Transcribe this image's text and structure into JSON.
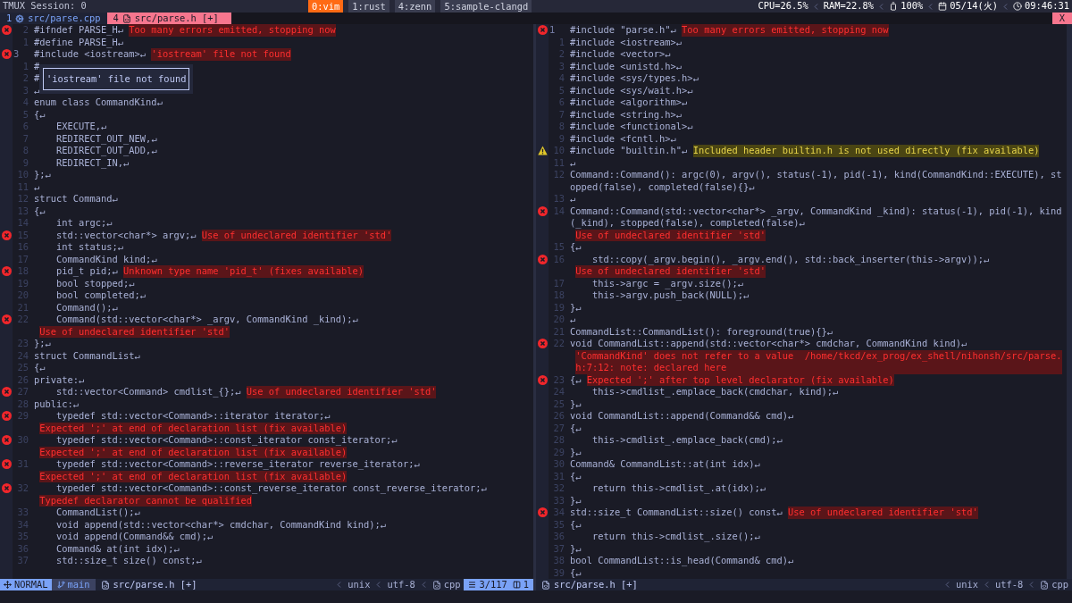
{
  "tmux": {
    "session": "TMUX Session: 0",
    "windows": [
      {
        "label": "0:vim",
        "selected": true
      },
      {
        "label": "1:rust",
        "selected": false
      },
      {
        "label": "4:zenn",
        "selected": false
      },
      {
        "label": "5:sample-clangd",
        "selected": false
      }
    ],
    "status": [
      {
        "kind": "cpu",
        "text": "CPU=26.5%"
      },
      {
        "kind": "ram",
        "text": "RAM=22.8%"
      },
      {
        "kind": "battery",
        "text": "100%"
      },
      {
        "kind": "date",
        "text": "05/14(火)"
      },
      {
        "kind": "clock",
        "text": "09:46:31"
      }
    ]
  },
  "tabline": {
    "tabs": [
      {
        "number": "1",
        "kind": "source",
        "label": "src/parse.cpp",
        "selected": false
      },
      {
        "number": "4",
        "kind": "header",
        "label": "src/parse.h [+]",
        "selected": true
      }
    ],
    "close": "X"
  },
  "panes": [
    {
      "lines": [
        {
          "n": "2",
          "kind": "error",
          "code": "#ifndef PARSE_H↵",
          "diag": "Too many errors emitted, stopping now"
        },
        {
          "n": "1",
          "code": "#define PARSE_H↵"
        },
        {
          "n": "3",
          "current": true,
          "kind": "error",
          "code": "#include <iostream>↵",
          "diag": "'iostream' file not found"
        },
        {
          "n": "1",
          "code": "#"
        },
        {
          "n": "2",
          "code": "#"
        },
        {
          "n": "3",
          "code": "↵"
        },
        {
          "n": "4",
          "code": "enum class CommandKind↵"
        },
        {
          "n": "5",
          "code": "{↵"
        },
        {
          "n": "6",
          "code": "    EXECUTE,↵"
        },
        {
          "n": "7",
          "code": "    REDIRECT_OUT_NEW,↵"
        },
        {
          "n": "8",
          "code": "    REDIRECT_OUT_ADD,↵"
        },
        {
          "n": "9",
          "code": "    REDIRECT_IN,↵"
        },
        {
          "n": "10",
          "code": "};↵"
        },
        {
          "n": "11",
          "code": "↵"
        },
        {
          "n": "12",
          "code": "struct Command↵"
        },
        {
          "n": "13",
          "code": "{↵"
        },
        {
          "n": "14",
          "code": "    int argc;↵"
        },
        {
          "n": "15",
          "kind": "error",
          "code": "    std::vector<char*> argv;↵",
          "diag": "Use of undeclared identifier 'std'"
        },
        {
          "n": "16",
          "code": "    int status;↵"
        },
        {
          "n": "17",
          "code": "    CommandKind kind;↵"
        },
        {
          "n": "18",
          "kind": "error",
          "code": "    pid_t pid;↵",
          "diag": "Unknown type name 'pid_t' (fixes available)"
        },
        {
          "n": "19",
          "code": "    bool stopped;↵"
        },
        {
          "n": "20",
          "code": "    bool completed;↵"
        },
        {
          "n": "21",
          "code": "    Command();↵"
        },
        {
          "n": "22",
          "kind": "error",
          "code": "    Command(std::vector<char*> _argv, CommandKind _kind);↵",
          "diag": "Use of undeclared identifier 'std'"
        },
        {
          "n": "23",
          "code": "};↵"
        },
        {
          "n": "24",
          "code": "struct CommandList↵"
        },
        {
          "n": "25",
          "code": "{↵"
        },
        {
          "n": "26",
          "code": "private:↵"
        },
        {
          "n": "27",
          "kind": "error",
          "code": "    std::vector<Command> cmdlist_{};↵",
          "diag": "Use of undeclared identifier 'std'"
        },
        {
          "n": "28",
          "code": "public:↵"
        },
        {
          "n": "29",
          "kind": "error",
          "code": "    typedef std::vector<Command>::iterator iterator;↵",
          "diag": "Expected ';' at end of declaration list (fix available)"
        },
        {
          "n": "30",
          "kind": "error",
          "code": "    typedef std::vector<Command>::const_iterator const_iterator;↵",
          "diag": "Expected ';' at end of declaration list (fix available)"
        },
        {
          "n": "31",
          "kind": "error",
          "code": "    typedef std::vector<Command>::reverse_iterator reverse_iterator;↵",
          "diag": "Expected ';' at end of declaration list (fix available)"
        },
        {
          "n": "32",
          "kind": "error",
          "code": "    typedef std::vector<Command>::const_reverse_iterator const_reverse_iterator;↵",
          "diag": "Typedef declarator cannot be qualified"
        },
        {
          "n": "33",
          "code": "    CommandList();↵"
        },
        {
          "n": "34",
          "code": "    void append(std::vector<char*> cmdchar, CommandKind kind);↵"
        },
        {
          "n": "35",
          "code": "    void append(Command&& cmd);↵"
        },
        {
          "n": "36",
          "code": "    Command& at(int idx);↵"
        },
        {
          "n": "37",
          "code": "    std::size_t size() const;↵"
        }
      ],
      "popup": "'iostream' file not found",
      "statusline": {
        "left": [
          {
            "kind": "mode",
            "text": "NORMAL"
          },
          {
            "kind": "branch",
            "text": "main"
          },
          {
            "kind": "file",
            "text": "src/parse.h [+]"
          }
        ],
        "right": [
          {
            "kind": "plain",
            "text": "unix"
          },
          {
            "kind": "plain",
            "text": "utf-8"
          },
          {
            "kind": "filetype",
            "text": "cpp"
          },
          {
            "kind": "position",
            "text": "3/117",
            "col": "1"
          }
        ]
      }
    },
    {
      "lines": [
        {
          "n": "1",
          "current": true,
          "kind": "error",
          "code": "#include \"parse.h\"↵",
          "diag": "Too many errors emitted, stopping now"
        },
        {
          "n": "1",
          "code": "#include <iostream>↵"
        },
        {
          "n": "2",
          "code": "#include <vector>↵"
        },
        {
          "n": "3",
          "code": "#include <unistd.h>↵"
        },
        {
          "n": "4",
          "code": "#include <sys/types.h>↵"
        },
        {
          "n": "5",
          "code": "#include <sys/wait.h>↵"
        },
        {
          "n": "6",
          "code": "#include <algorithm>↵"
        },
        {
          "n": "7",
          "code": "#include <string.h>↵"
        },
        {
          "n": "8",
          "code": "#include <functional>↵"
        },
        {
          "n": "9",
          "code": "#include <fcntl.h>↵"
        },
        {
          "n": "10",
          "kind": "warning",
          "code": "#include \"builtin.h\"↵",
          "diag": "Included header builtin.h is not used directly (fix available)"
        },
        {
          "n": "11",
          "code": "↵"
        },
        {
          "n": "12",
          "code": "Command::Command(): argc(0), argv(), status(-1), pid(-1), kind(CommandKind::EXECUTE), stopped(false), completed(false){}↵"
        },
        {
          "n": "13",
          "code": "↵"
        },
        {
          "n": "14",
          "kind": "error",
          "code": "Command::Command(std::vector<char*> _argv, CommandKind _kind): status(-1), pid(-1), kind(_kind), stopped(false), completed(false)↵",
          "diag": "Use of undeclared identifier 'std'"
        },
        {
          "n": "15",
          "code": "{↵"
        },
        {
          "n": "16",
          "kind": "error",
          "code": "    std::copy(_argv.begin(), _argv.end(), std::back_inserter(this->argv));↵",
          "diag": "Use of undeclared identifier 'std'"
        },
        {
          "n": "17",
          "code": "    this->argc = _argv.size();↵"
        },
        {
          "n": "18",
          "code": "    this->argv.push_back(NULL);↵"
        },
        {
          "n": "19",
          "code": "}↵"
        },
        {
          "n": "20",
          "code": "↵"
        },
        {
          "n": "21",
          "code": "CommandList::CommandList(): foreground(true){}↵"
        },
        {
          "n": "22",
          "kind": "error",
          "code": "void CommandList::append(std::vector<char*> cmdchar, CommandKind kind)↵",
          "diag": "'CommandKind' does not refer to a value  /home/tkcd/ex_prog/ex_shell/nihonsh/src/parse.h:7:12: note: declared here"
        },
        {
          "n": "23",
          "kind": "error",
          "code": "{↵",
          "diag": "Expected ';' after top level declarator (fix available)"
        },
        {
          "n": "24",
          "code": "    this->cmdlist_.emplace_back(cmdchar, kind);↵"
        },
        {
          "n": "25",
          "code": "}↵"
        },
        {
          "n": "26",
          "code": "void CommandList::append(Command&& cmd)↵"
        },
        {
          "n": "27",
          "code": "{↵"
        },
        {
          "n": "28",
          "code": "    this->cmdlist_.emplace_back(cmd);↵"
        },
        {
          "n": "29",
          "code": "}↵"
        },
        {
          "n": "30",
          "code": "Command& CommandList::at(int idx)↵"
        },
        {
          "n": "31",
          "code": "{↵"
        },
        {
          "n": "32",
          "code": "    return this->cmdlist_.at(idx);↵"
        },
        {
          "n": "33",
          "code": "}↵"
        },
        {
          "n": "34",
          "kind": "error",
          "code": "std::size_t CommandList::size() const↵",
          "diag": "Use of undeclared identifier 'std'"
        },
        {
          "n": "35",
          "code": "{↵"
        },
        {
          "n": "36",
          "code": "    return this->cmdlist_.size();↵"
        },
        {
          "n": "37",
          "code": "}↵"
        },
        {
          "n": "38",
          "code": "bool CommandList::is_head(Command& cmd)↵"
        },
        {
          "n": "39",
          "code": "{↵"
        }
      ],
      "statusline": {
        "left": [
          {
            "kind": "file",
            "text": "src/parse.h [+]"
          }
        ],
        "right": [
          {
            "kind": "plain",
            "text": "unix"
          },
          {
            "kind": "plain",
            "text": "utf-8"
          },
          {
            "kind": "filetype",
            "text": "cpp"
          }
        ]
      }
    }
  ]
}
